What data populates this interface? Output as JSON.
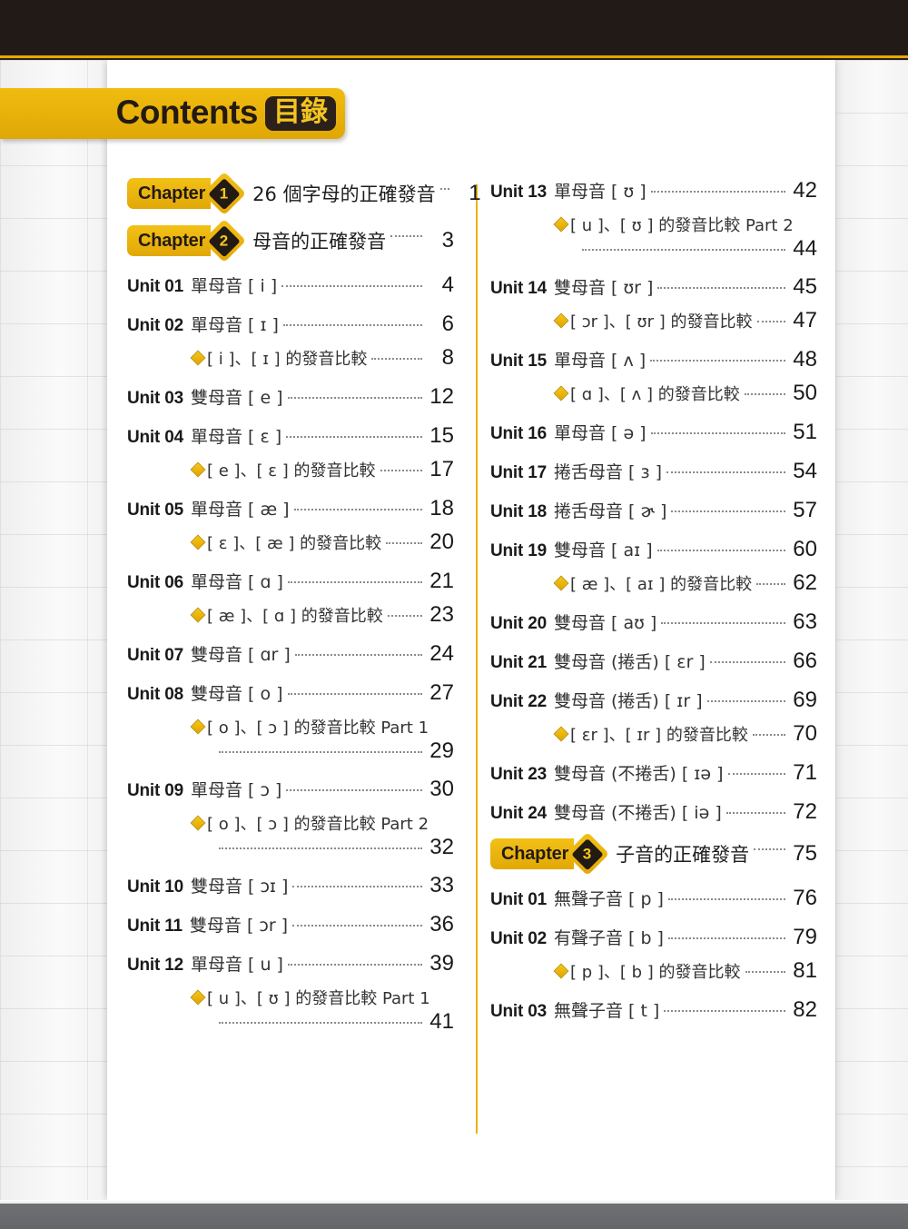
{
  "header": {
    "banner_en": "Contents",
    "banner_zh": "目錄"
  },
  "columns": {
    "left": [
      {
        "kind": "chapter",
        "badge": "Chapter",
        "num": "1",
        "title": "26 個字母的正確發音",
        "page": "1"
      },
      {
        "kind": "chapter",
        "badge": "Chapter",
        "num": "2",
        "title": "母音的正確發音",
        "page": "3"
      },
      {
        "kind": "unit",
        "label": "Unit 01",
        "title": "單母音 [ i ]",
        "page": "4"
      },
      {
        "kind": "unit",
        "label": "Unit 02",
        "title": "單母音 [ ɪ ]",
        "page": "6"
      },
      {
        "kind": "sub",
        "title": "[ i ]、[ ɪ ] 的發音比較",
        "page": "8"
      },
      {
        "kind": "unit",
        "label": "Unit 03",
        "title": "雙母音 [ e ]",
        "page": "12"
      },
      {
        "kind": "unit",
        "label": "Unit 04",
        "title": "單母音 [ ɛ ]",
        "page": "15"
      },
      {
        "kind": "sub",
        "title": "[ e ]、[ ɛ ] 的發音比較",
        "page": "17"
      },
      {
        "kind": "unit",
        "label": "Unit 05",
        "title": "單母音 [ æ ]",
        "page": "18"
      },
      {
        "kind": "sub",
        "title": "[ ɛ ]、[ æ ] 的發音比較",
        "page": "20"
      },
      {
        "kind": "unit",
        "label": "Unit 06",
        "title": "單母音 [ ɑ ]",
        "page": "21"
      },
      {
        "kind": "sub",
        "title": "[ æ ]、[ ɑ ] 的發音比較",
        "page": "23"
      },
      {
        "kind": "unit",
        "label": "Unit 07",
        "title": "雙母音 [ ɑr ]",
        "page": "24"
      },
      {
        "kind": "unit",
        "label": "Unit 08",
        "title": "雙母音 [ o ]",
        "page": "27"
      },
      {
        "kind": "sub-wrap",
        "title": "[ o ]、[ ɔ ] 的發音比較 Part 1",
        "page": "29"
      },
      {
        "kind": "unit",
        "label": "Unit 09",
        "title": "單母音 [ ɔ ]",
        "page": "30"
      },
      {
        "kind": "sub-wrap",
        "title": "[ o ]、[ ɔ ] 的發音比較 Part 2",
        "page": "32"
      },
      {
        "kind": "unit",
        "label": "Unit 10",
        "title": "雙母音 [ ɔɪ ]",
        "page": "33"
      },
      {
        "kind": "unit",
        "label": "Unit 11",
        "title": "雙母音 [ ɔr ]",
        "page": "36"
      },
      {
        "kind": "unit",
        "label": "Unit 12",
        "title": "單母音 [ u ]",
        "page": "39"
      },
      {
        "kind": "sub-wrap",
        "title": "[ u ]、[ ʊ ] 的發音比較 Part 1",
        "page": "41"
      }
    ],
    "right": [
      {
        "kind": "unit",
        "label": "Unit 13",
        "title": "單母音 [ ʊ ]",
        "page": "42"
      },
      {
        "kind": "sub-wrap",
        "title": "[ u ]、[ ʊ ] 的發音比較 Part 2",
        "page": "44"
      },
      {
        "kind": "unit",
        "label": "Unit 14",
        "title": "雙母音 [ ʊr ]",
        "page": "45"
      },
      {
        "kind": "sub",
        "title": "[ ɔr ]、[ ʊr ] 的發音比較",
        "page": "47"
      },
      {
        "kind": "unit",
        "label": "Unit 15",
        "title": "單母音 [ ʌ ]",
        "page": "48"
      },
      {
        "kind": "sub",
        "title": "[ ɑ ]、[ ʌ ] 的發音比較",
        "page": "50"
      },
      {
        "kind": "unit",
        "label": "Unit 16",
        "title": "單母音 [ ə ]",
        "page": "51"
      },
      {
        "kind": "unit",
        "label": "Unit 17",
        "title": "捲舌母音 [ ɜ ]",
        "page": "54"
      },
      {
        "kind": "unit",
        "label": "Unit 18",
        "title": "捲舌母音 [ ɚ ]",
        "page": "57"
      },
      {
        "kind": "unit",
        "label": "Unit 19",
        "title": "雙母音 [ aɪ ]",
        "page": "60"
      },
      {
        "kind": "sub",
        "title": "[ æ ]、[ aɪ ] 的發音比較",
        "page": "62"
      },
      {
        "kind": "unit",
        "label": "Unit 20",
        "title": "雙母音 [ aʊ ]",
        "page": "63"
      },
      {
        "kind": "unit",
        "label": "Unit 21",
        "title": "雙母音 (捲舌) [ ɛr ]",
        "page": "66"
      },
      {
        "kind": "unit",
        "label": "Unit 22",
        "title": "雙母音 (捲舌) [ ɪr ]",
        "page": "69"
      },
      {
        "kind": "sub",
        "title": "[ ɛr ]、[ ɪr ] 的發音比較",
        "page": "70"
      },
      {
        "kind": "unit",
        "label": "Unit 23",
        "title": "雙母音 (不捲舌) [ ɪə ]",
        "page": "71"
      },
      {
        "kind": "unit",
        "label": "Unit 24",
        "title": "雙母音 (不捲舌) [ iə ]",
        "page": "72"
      },
      {
        "kind": "chapter",
        "badge": "Chapter",
        "num": "3",
        "title": "子音的正確發音",
        "page": "75"
      },
      {
        "kind": "unit",
        "label": "Unit 01",
        "title": "無聲子音 [ p ]",
        "page": "76"
      },
      {
        "kind": "unit",
        "label": "Unit 02",
        "title": "有聲子音 [ b ]",
        "page": "79"
      },
      {
        "kind": "sub",
        "title": "[ p ]、[ b ] 的發音比較",
        "page": "81"
      },
      {
        "kind": "unit",
        "label": "Unit 03",
        "title": "無聲子音 [ t ]",
        "page": "82"
      }
    ]
  },
  "colors": {
    "accent_yellow": "#e8a900",
    "badge_gold": "#f0bc10",
    "dark_brown": "#231a14",
    "divider": "#eeb20c",
    "text": "#1a1a1a"
  }
}
